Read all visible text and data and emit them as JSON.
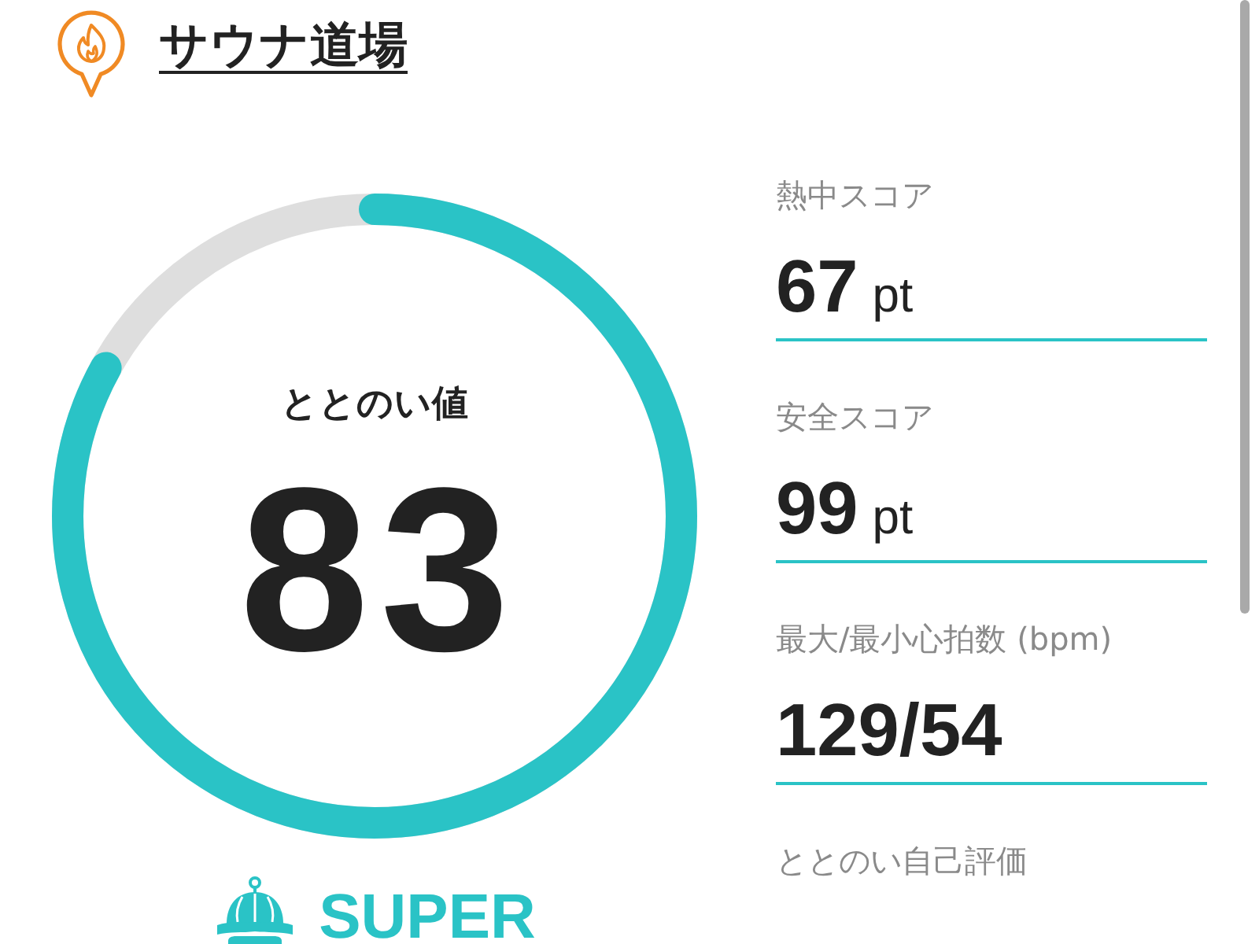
{
  "header": {
    "title": "サウナ道場"
  },
  "gauge": {
    "title": "ととのい値",
    "value": "83",
    "level": 0.83
  },
  "rating": {
    "label": "SUPER"
  },
  "stats": [
    {
      "label": "熱中スコア",
      "value": "67",
      "unit": "pt"
    },
    {
      "label": "安全スコア",
      "value": "99",
      "unit": "pt"
    },
    {
      "label": "最大/最小心拍数 (bpm)",
      "value": "129/54"
    },
    {
      "label": "ととのい自己評価"
    }
  ]
}
